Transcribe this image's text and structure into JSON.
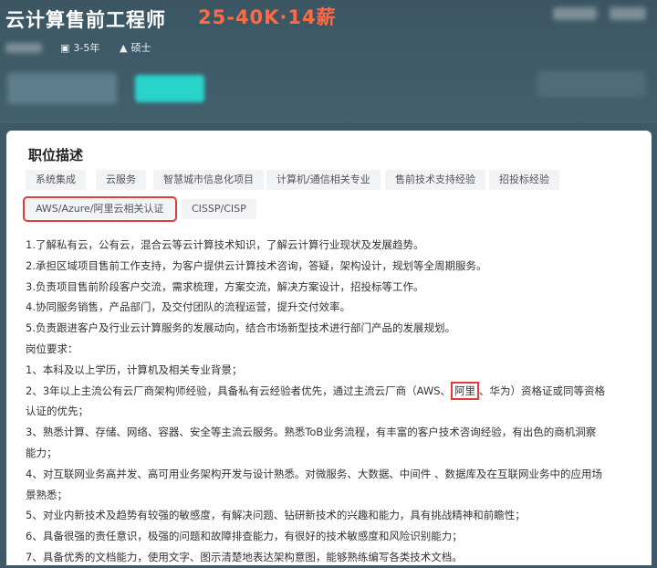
{
  "job": {
    "title": "云计算售前工程师",
    "salary": "25-40K·14薪",
    "experience": "3-5年",
    "education": "硕士"
  },
  "icons": {
    "briefcase": "briefcase-icon",
    "graduation": "graduation-cap-icon"
  },
  "description": {
    "section_title": "职位描述",
    "tags": [
      "系统集成",
      "云服务",
      "智慧城市信息化项目",
      "计算机/通信相关专业",
      "售前技术支持经验",
      "招投标经验",
      "AWS/Azure/阿里云相关认证",
      "CISSP/CISP"
    ],
    "lines": [
      "1.了解私有云，公有云，混合云等云计算技术知识，了解云计算行业现状及发展趋势。",
      "2.承担区域项目售前工作支持，为客户提供云计算技术咨询，答疑，架构设计，规划等全周期服务。",
      "3.负责项目售前阶段客户交流，需求梳理，方案交流，解决方案设计，招投标等工作。",
      "4.协同服务销售，产品部门，及交付团队的流程运营，提升交付效率。",
      "5.负责跟进客户及行业云计算服务的发展动向，结合市场新型技术进行部门产品的发展规划。",
      "岗位要求：",
      "1、本科及以上学历，计算机及相关专业背景；"
    ],
    "line2_before": "2、3年以上主流公有云厂商架构师经验，具备私有云经验者优先，通过主流云厂商（AWS、",
    "line2_boxed": "阿里",
    "line2_after": "、华为）资格证或同等资格",
    "line2_cont": "认证的优先；",
    "lines_rest": [
      "3、熟悉计算、存储、网络、容器、安全等主流云服务。熟悉ToB业务流程，有丰富的客户技术咨询经验，有出色的商机洞察",
      "能力；",
      "4、对互联网业务高并发、高可用业务架构开发与设计熟悉。对微服务、大数据、中间件 、数据库及在互联网业务中的应用场",
      "景熟悉；",
      "5、对业内新技术及趋势有较强的敏感度，有解决问题、钻研新技术的兴趣和能力，具有挑战精神和前瞻性；",
      "6、具备很强的责任意识，极强的问题和故障排查能力，有很好的技术敏感度和风险识别能力；",
      "7、具备优秀的文档能力，使用文字、图示清楚地表达架构意图，能够熟练编写各类技术文档。"
    ]
  }
}
